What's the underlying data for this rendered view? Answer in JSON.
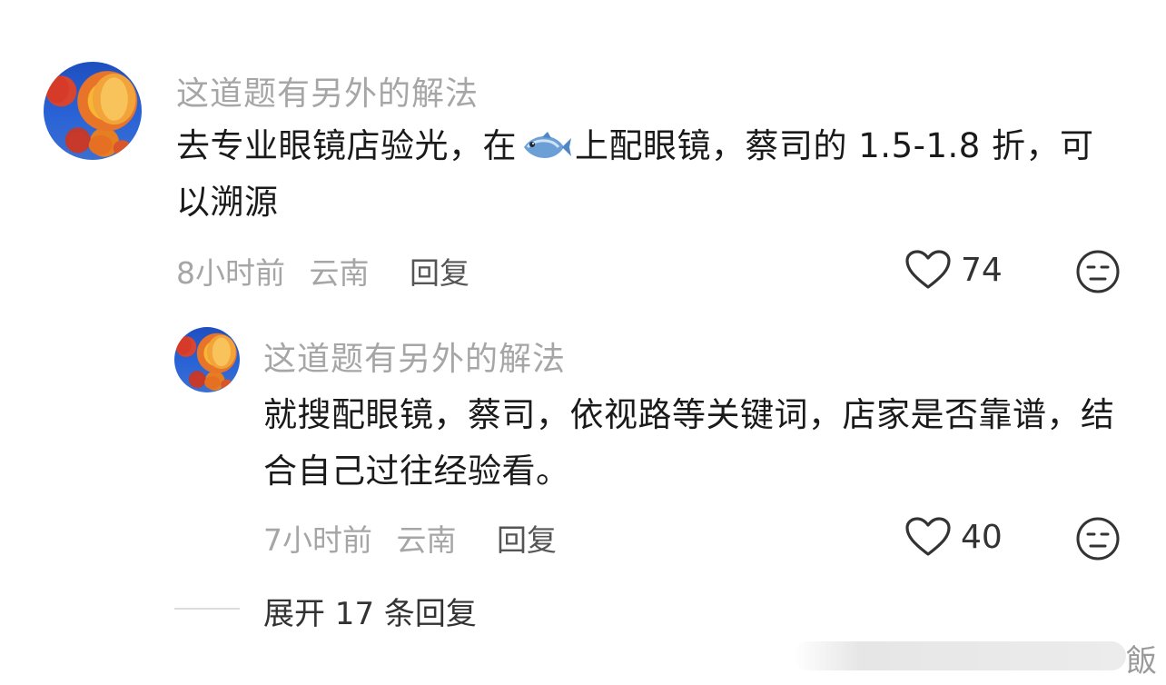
{
  "comments": [
    {
      "username": "这道题有另外的解法",
      "body_before_icon": "去专业眼镜店验光，在",
      "icon": "fish-emoji",
      "body_after_icon": "上配眼镜，蔡司的 1.5-1.8 折，可以溯源",
      "time": "8小时前",
      "location": "云南",
      "reply_label": "回复",
      "likes": "74"
    },
    {
      "username": "这道题有另外的解法",
      "body": "就搜配眼镜，蔡司，依视路等关键词，店家是否靠谱，结合自己过往经验看。",
      "time": "7小时前",
      "location": "云南",
      "reply_label": "回复",
      "likes": "40"
    }
  ],
  "expand_replies": "展开 17 条回复",
  "watermark": "飯",
  "colors": {
    "username": "#a6a6a6",
    "body": "#1a1a1a",
    "meta": "#a6a6a6",
    "reply": "#555555"
  },
  "icons": [
    "heart-outline-icon",
    "dislike-face-icon",
    "fish-emoji"
  ]
}
